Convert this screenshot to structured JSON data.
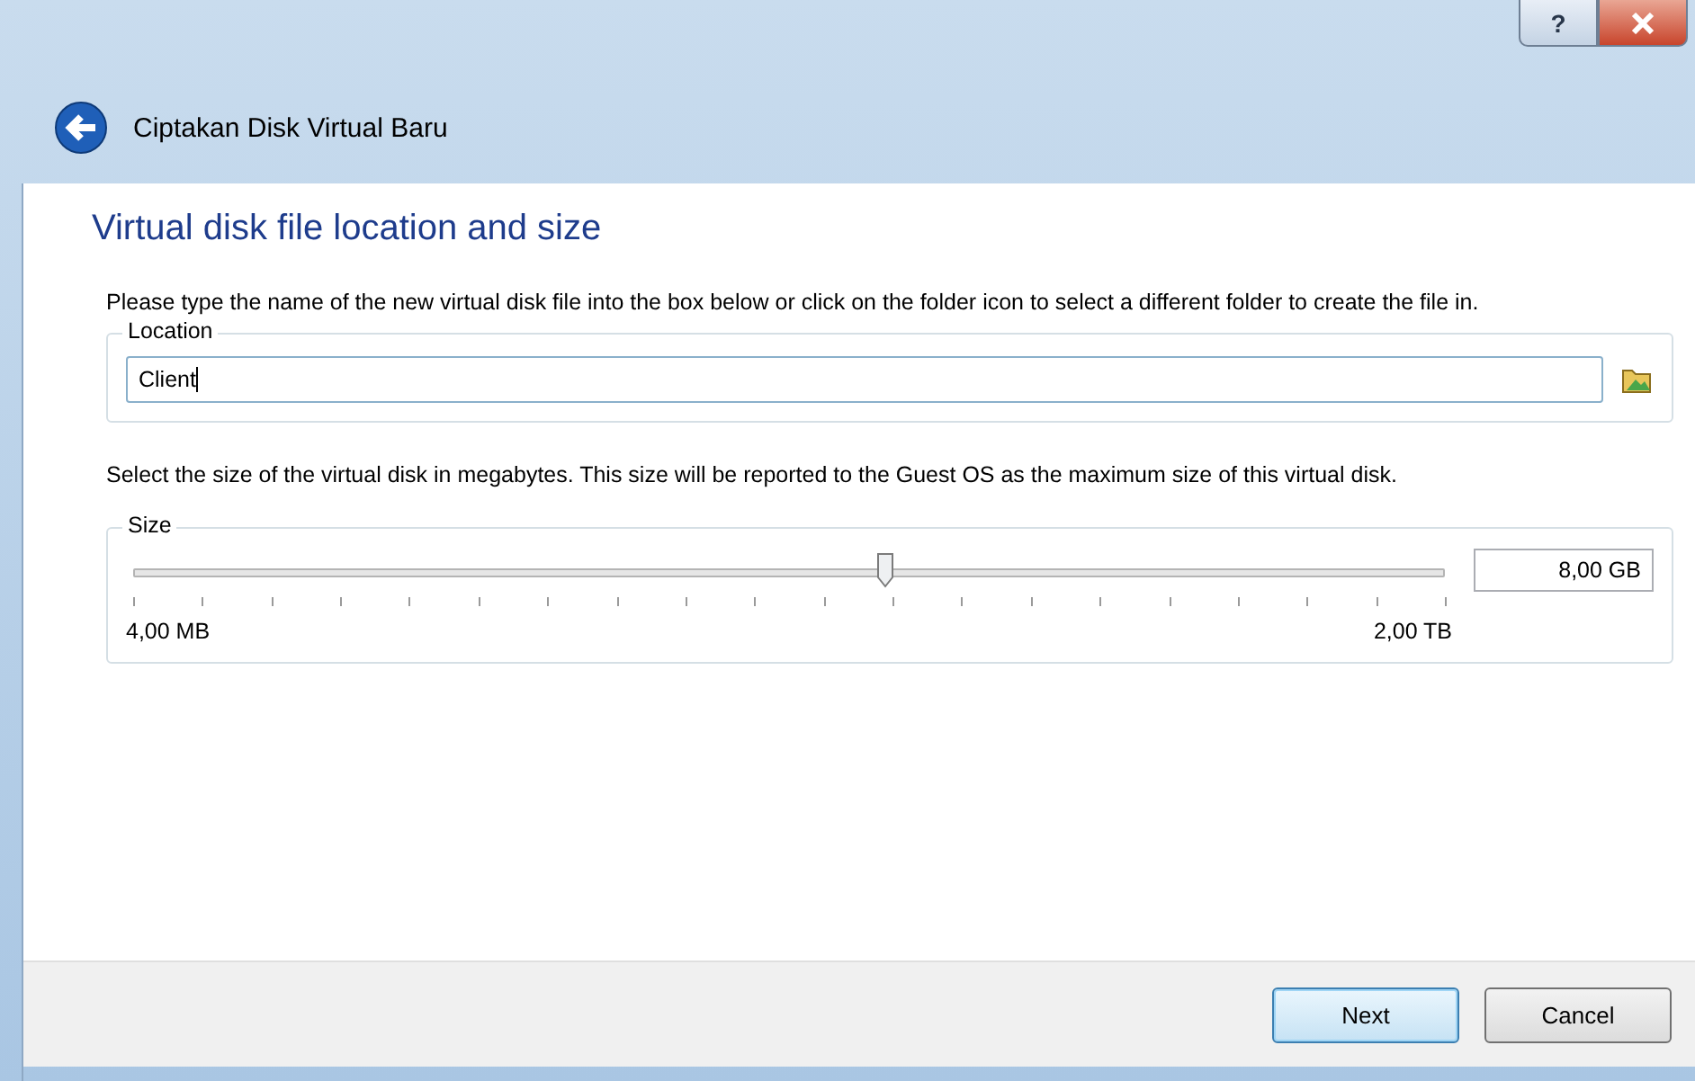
{
  "window": {
    "title": "Ciptakan Disk Virtual Baru",
    "help_glyph": "?"
  },
  "page": {
    "heading": "Virtual disk file location and size",
    "location_intro": "Please type the name of the new virtual disk file into the box below or click on the folder icon to select a different folder to create the file in.",
    "location": {
      "label": "Location",
      "value": "Client"
    },
    "size_intro": "Select the size of the virtual disk in megabytes. This size will be reported to the Guest OS as the maximum size of this virtual disk.",
    "size": {
      "label": "Size",
      "level": 0.575,
      "value": "8,00 GB",
      "min_label": "4,00 MB",
      "max_label": "2,00 TB"
    }
  },
  "buttons": [
    {
      "label": "Next",
      "default": true
    },
    {
      "label": "Cancel",
      "default": false
    }
  ]
}
